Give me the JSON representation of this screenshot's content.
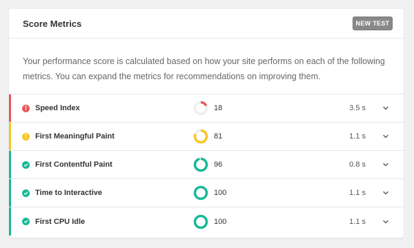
{
  "header": {
    "title": "Score Metrics",
    "new_test_label": "NEW TEST"
  },
  "description": "Your performance score is calculated based on how your site performs on each of the following metrics. You can expand the metrics for recommendations on improving them.",
  "colors": {
    "poor": "#e8585a",
    "average": "#f7c623",
    "good": "#17b897"
  },
  "metrics": [
    {
      "name": "Speed Index",
      "score": "18",
      "score_value": 18,
      "time": "3.5 s",
      "status": "poor",
      "icon": "exclamation-icon"
    },
    {
      "name": "First Meaningful Paint",
      "score": "81",
      "score_value": 81,
      "time": "1.1 s",
      "status": "average",
      "icon": "exclamation-icon"
    },
    {
      "name": "First Contentful Paint",
      "score": "96",
      "score_value": 96,
      "time": "0.8 s",
      "status": "good",
      "icon": "check-icon"
    },
    {
      "name": "Time to Interactive",
      "score": "100",
      "score_value": 100,
      "time": "1.1 s",
      "status": "good",
      "icon": "check-icon"
    },
    {
      "name": "First CPU Idle",
      "score": "100",
      "score_value": 100,
      "time": "1.1 s",
      "status": "good",
      "icon": "check-icon"
    }
  ]
}
